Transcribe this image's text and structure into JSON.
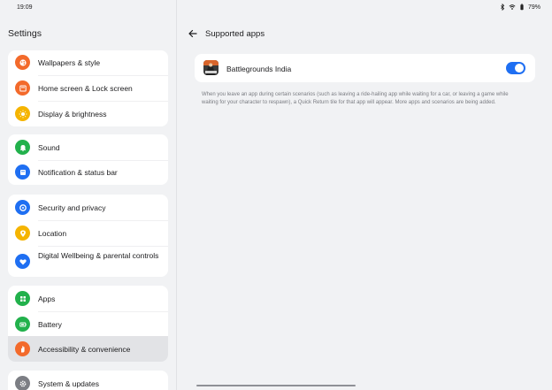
{
  "status": {
    "time": "19:09",
    "battery": "79%",
    "icons": [
      "bluetooth-icon",
      "wifi-icon",
      "battery-icon"
    ]
  },
  "sidebar": {
    "title": "Settings",
    "groups": [
      {
        "items": [
          {
            "label": "Wallpapers & style",
            "icon": "palette-icon",
            "color": "#f36a2b"
          },
          {
            "label": "Home screen & Lock screen",
            "icon": "home-screen-icon",
            "color": "#f36a2b"
          },
          {
            "label": "Display & brightness",
            "icon": "sun-icon",
            "color": "#f5b400"
          }
        ]
      },
      {
        "items": [
          {
            "label": "Sound",
            "icon": "bell-icon",
            "color": "#22b14c"
          },
          {
            "label": "Notification & status bar",
            "icon": "notification-icon",
            "color": "#1f6ff2"
          }
        ]
      },
      {
        "items": [
          {
            "label": "Security and privacy",
            "icon": "shield-icon",
            "color": "#1f6ff2"
          },
          {
            "label": "Location",
            "icon": "location-pin-icon",
            "color": "#f5b400"
          },
          {
            "label": "Digital Wellbeing & parental controls",
            "icon": "heart-icon",
            "color": "#1f6ff2"
          }
        ]
      },
      {
        "items": [
          {
            "label": "Apps",
            "icon": "apps-grid-icon",
            "color": "#22b14c"
          },
          {
            "label": "Battery",
            "icon": "battery-icon",
            "color": "#22b14c"
          },
          {
            "label": "Accessibility & convenience",
            "icon": "hand-icon",
            "color": "#f36a2b",
            "active": true
          }
        ]
      },
      {
        "items": [
          {
            "label": "System & updates",
            "icon": "gear-icon",
            "color": "#7c7e84"
          }
        ]
      }
    ]
  },
  "main": {
    "title": "Supported apps",
    "app": {
      "name": "Battlegrounds India",
      "enabled": true
    },
    "description": "When you leave an app during certain scenarios (such as leaving a ride-hailing app while waiting for a car, or leaving a game while waiting for your character to respawn), a Quick Return tile for that app will appear. More apps and scenarios are being added."
  }
}
